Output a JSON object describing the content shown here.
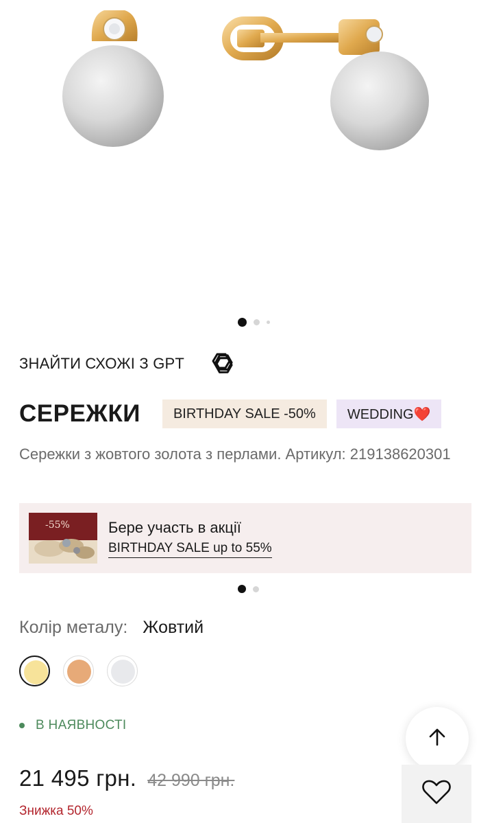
{
  "gallery": {
    "dots_count": 3,
    "active_index": 0
  },
  "gpt": {
    "label": "ЗНАЙТИ СХОЖІ З GPT",
    "icon": "openai-icon"
  },
  "product": {
    "title": "СЕРЕЖКИ",
    "badges": [
      {
        "label": "BIRTHDAY SALE -50%",
        "color": "#f5ebe0"
      },
      {
        "label": "WEDDING❤️",
        "color": "#ede5f6"
      }
    ],
    "description": "Сережки з жовтого золота з перлами. Артикул: 219138620301"
  },
  "promo": {
    "image_text": "-55%",
    "line1": "Бере участь в акції",
    "line2": "BIRTHDAY SALE up to 55%",
    "dots_count": 2,
    "active_index": 0
  },
  "metal": {
    "label": "Колір металу:",
    "value": "Жовтий",
    "options": [
      {
        "name": "yellow-gold",
        "color": "#f7e39a",
        "selected": true
      },
      {
        "name": "rose-gold",
        "color": "#e7aa78",
        "selected": false
      },
      {
        "name": "white-gold",
        "color": "#e8e9ec",
        "selected": false
      }
    ]
  },
  "stock": {
    "label": "В НАЯВНОСТІ",
    "color": "#4d8a5c"
  },
  "price": {
    "current": "21 495 грн.",
    "old": "42 990 грн.",
    "discount": "Знижка 50%",
    "discount_color": "#b3262e"
  },
  "actions": {
    "scroll_up_icon": "arrow-up-icon",
    "favorite_icon": "heart-icon"
  }
}
